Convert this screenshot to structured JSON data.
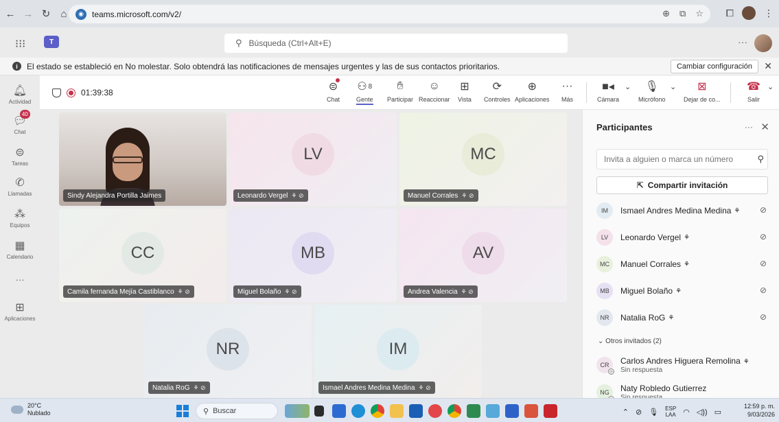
{
  "browser": {
    "url": "teams.microsoft.com/v2/"
  },
  "teams": {
    "search_placeholder": "Búsqueda (Ctrl+Alt+E)",
    "more": "···"
  },
  "banner": {
    "message": "El estado se estableció en No molestar. Solo obtendrá las notificaciones de mensajes urgentes y las de sus contactos prioritarios.",
    "button": "Cambiar configuración"
  },
  "rail": {
    "items": [
      {
        "label": "Actividad",
        "icon": "bell-icon"
      },
      {
        "label": "Chat",
        "icon": "chat-icon",
        "badge": "40"
      },
      {
        "label": "Tareas",
        "icon": "tasks-icon"
      },
      {
        "label": "Llamadas",
        "icon": "phone-icon"
      },
      {
        "label": "Equipos",
        "icon": "teams-icon"
      },
      {
        "label": "Calendario",
        "icon": "calendar-icon"
      },
      {
        "label": "···",
        "icon": "more-icon"
      },
      {
        "label": "Aplicaciones",
        "icon": "apps-icon"
      }
    ]
  },
  "meeting": {
    "timer": "01:39:38",
    "toolbar": {
      "chat": "Chat",
      "people": "Gente",
      "people_count": "8",
      "raise": "Participar",
      "react": "Reaccionar",
      "view": "Vista",
      "controls": "Controles",
      "apps": "Aplicaciones",
      "more": "Más",
      "camera": "Cámara",
      "mic": "Micrófono",
      "stop_share": "Dejar de co...",
      "leave": "Salir"
    }
  },
  "tiles": [
    {
      "name": "Sindy Alejandra Portilla Jaimes",
      "initials": ""
    },
    {
      "name": "Leonardo Vergel",
      "initials": "LV"
    },
    {
      "name": "Manuel Corrales",
      "initials": "MC"
    },
    {
      "name": "Camila fernanda Mejía Castiblanco",
      "initials": "CC"
    },
    {
      "name": "Miguel Bolaño",
      "initials": "MB"
    },
    {
      "name": "Andrea Valencia",
      "initials": "AV"
    },
    {
      "name": "Natalia RoG",
      "initials": "NR"
    },
    {
      "name": "Ismael Andres Medina Medina",
      "initials": "IM"
    }
  ],
  "panel": {
    "title": "Participantes",
    "more": "···",
    "invite_placeholder": "Invita a alguien o marca un número",
    "share_label": "Compartir invitación",
    "participants": [
      {
        "initials": "IM",
        "name": "Ismael Andres Medina Medina",
        "color": "#e3ecf2"
      },
      {
        "initials": "LV",
        "name": "Leonardo Vergel",
        "color": "#f4e1ea"
      },
      {
        "initials": "MC",
        "name": "Manuel Corrales",
        "color": "#e9f0dc"
      },
      {
        "initials": "MB",
        "name": "Miguel Bolaño",
        "color": "#e6e0f3"
      },
      {
        "initials": "NR",
        "name": "Natalia RoG",
        "color": "#e3e8ee"
      }
    ],
    "group_label": "Otros invitados (2)",
    "guests": [
      {
        "initials": "CR",
        "name": "Carlos Andres Higuera Remolina",
        "status": "Sin respuesta",
        "color": "#f1e3ec"
      },
      {
        "initials": "NG",
        "name": "Naty Robledo Gutierrez",
        "status": "Sin respuesta",
        "color": "#e5f0df"
      }
    ]
  },
  "taskbar": {
    "temp": "20°C",
    "weather": "Nublado",
    "search": "Buscar",
    "lang1": "ESP",
    "lang2": "LAA",
    "time": "12:59 p. m.",
    "date": "9/03/2026"
  }
}
